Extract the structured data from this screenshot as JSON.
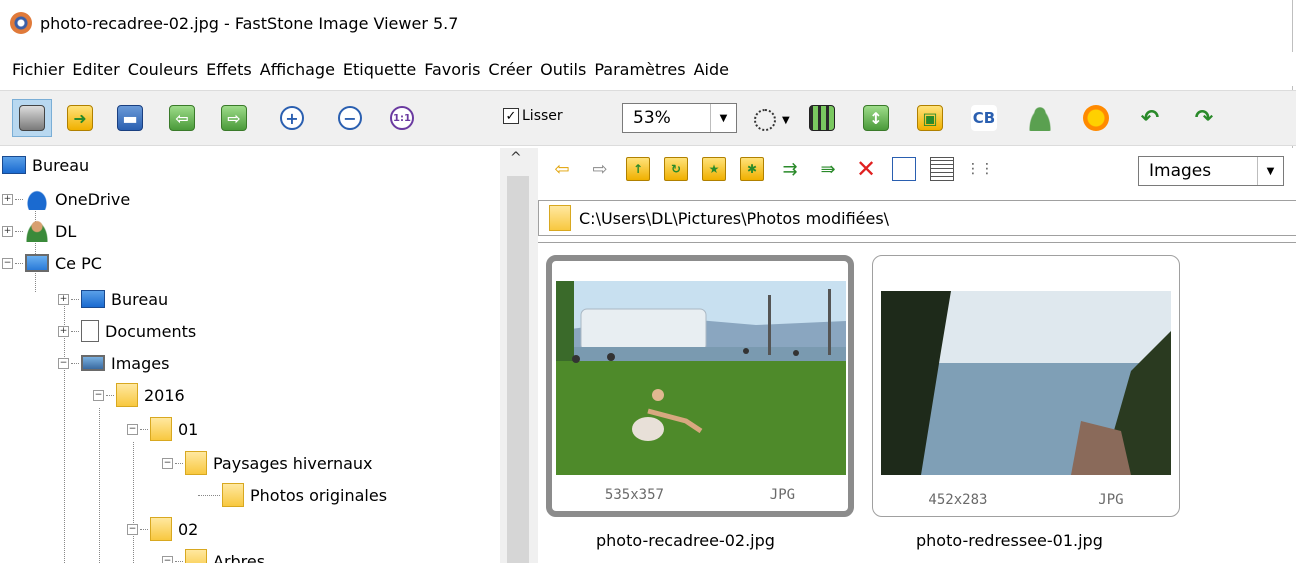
{
  "window": {
    "title": "photo-recadree-02.jpg  -  FastStone Image Viewer 5.7"
  },
  "menu": [
    "Fichier",
    "Editer",
    "Couleurs",
    "Effets",
    "Affichage",
    "Etiquette",
    "Favoris",
    "Créer",
    "Outils",
    "Paramètres",
    "Aide"
  ],
  "toolbar": {
    "smooth_label": "Lisser",
    "smooth_checked": true,
    "zoom": "53%"
  },
  "tree": [
    {
      "label": "Bureau",
      "icon": "desktop-icon"
    },
    {
      "label": "OneDrive",
      "icon": "onedrive-icon"
    },
    {
      "label": "DL",
      "icon": "user-icon"
    },
    {
      "label": "Ce PC",
      "icon": "computer-icon"
    },
    {
      "label": "Bureau",
      "icon": "desktop-icon"
    },
    {
      "label": "Documents",
      "icon": "documents-icon"
    },
    {
      "label": "Images",
      "icon": "pictures-icon"
    },
    {
      "label": "2016",
      "icon": "folder-icon"
    },
    {
      "label": "01",
      "icon": "folder-icon"
    },
    {
      "label": "Paysages hivernaux",
      "icon": "folder-icon"
    },
    {
      "label": "Photos originales",
      "icon": "folder-icon"
    },
    {
      "label": "02",
      "icon": "folder-icon"
    },
    {
      "label": "Arbres",
      "icon": "folder-icon"
    }
  ],
  "browser": {
    "filter": "Images",
    "path": "C:\\Users\\DL\\Pictures\\Photos modifiées\\",
    "thumbnails": [
      {
        "dims": "535x357",
        "type": "JPG",
        "filename": "photo-recadree-02.jpg",
        "selected": true
      },
      {
        "dims": "452x283",
        "type": "JPG",
        "filename": "photo-redressee-01.jpg",
        "selected": false
      }
    ]
  }
}
